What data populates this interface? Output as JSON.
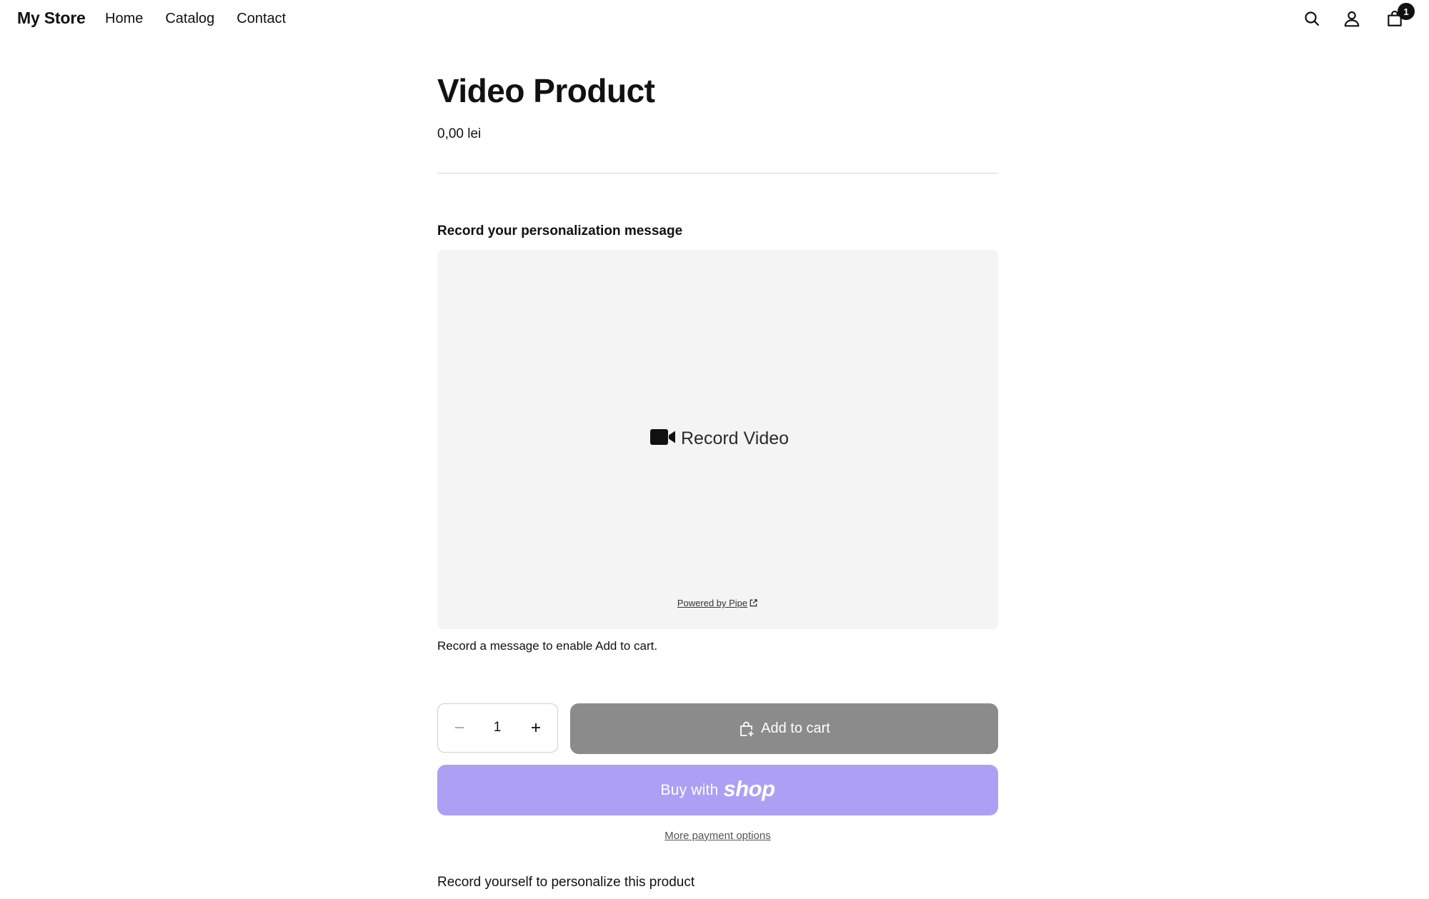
{
  "header": {
    "brand": "My Store",
    "nav": [
      "Home",
      "Catalog",
      "Contact"
    ],
    "icons": {
      "search": "search-icon",
      "account": "user-icon",
      "cart": "cart-icon"
    },
    "cart_count": "1"
  },
  "product": {
    "title": "Video Product",
    "price": "0,00 lei"
  },
  "recorder": {
    "heading": "Record your personalization message",
    "record_label": "Record Video",
    "record_icon": "video-camera-icon",
    "powered_by": "Powered by Pipe",
    "hint": "Record a message to enable Add to cart."
  },
  "purchase": {
    "quantity": "1",
    "add_to_cart": "Add to cart",
    "add_to_cart_color": "#8b8b8b",
    "buy_with": "Buy with",
    "shop_logo": "shop",
    "shop_color": "#ad9ff4",
    "more_payment_options": "More payment options"
  },
  "description": "Record yourself to personalize this product"
}
